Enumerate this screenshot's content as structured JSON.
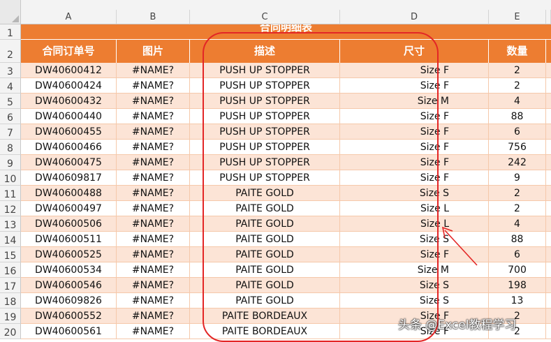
{
  "columns": [
    "A",
    "B",
    "C",
    "D",
    "E"
  ],
  "title": "合同明细表",
  "headers": [
    "合同订单号",
    "图片",
    "描述",
    "尺寸",
    "数量"
  ],
  "row_numbers": [
    "1",
    "2",
    "3",
    "4",
    "5",
    "6",
    "7",
    "8",
    "9",
    "10",
    "11",
    "12",
    "13",
    "14",
    "15",
    "16",
    "17",
    "18",
    "19",
    "20"
  ],
  "rows": [
    {
      "order": "DW40600412",
      "image": "#NAME?",
      "desc": "PUSH UP STOPPER",
      "size": "Size F",
      "qty": "2"
    },
    {
      "order": "DW40600424",
      "image": "#NAME?",
      "desc": "PUSH UP STOPPER",
      "size": "Size F",
      "qty": "2"
    },
    {
      "order": "DW40600432",
      "image": "#NAME?",
      "desc": "PUSH UP STOPPER",
      "size": "Size M",
      "qty": "4"
    },
    {
      "order": "DW40600440",
      "image": "#NAME?",
      "desc": "PUSH UP STOPPER",
      "size": "Size F",
      "qty": "88"
    },
    {
      "order": "DW40600455",
      "image": "#NAME?",
      "desc": "PUSH UP STOPPER",
      "size": "Size F",
      "qty": "6"
    },
    {
      "order": "DW40600466",
      "image": "#NAME?",
      "desc": "PUSH UP STOPPER",
      "size": "Size F",
      "qty": "756"
    },
    {
      "order": "DW40600475",
      "image": "#NAME?",
      "desc": "PUSH UP STOPPER",
      "size": "Size F",
      "qty": "242"
    },
    {
      "order": "DW40609817",
      "image": "#NAME?",
      "desc": "PUSH UP STOPPER",
      "size": "Size F",
      "qty": "9"
    },
    {
      "order": "DW40600488",
      "image": "#NAME?",
      "desc": "PAITE GOLD",
      "size": "Size S",
      "qty": "2"
    },
    {
      "order": "DW40600497",
      "image": "#NAME?",
      "desc": "PAITE GOLD",
      "size": "Size L",
      "qty": "2"
    },
    {
      "order": "DW40600506",
      "image": "#NAME?",
      "desc": "PAITE GOLD",
      "size": "Size L",
      "qty": "4"
    },
    {
      "order": "DW40600511",
      "image": "#NAME?",
      "desc": "PAITE GOLD",
      "size": "Size S",
      "qty": "88"
    },
    {
      "order": "DW40600525",
      "image": "#NAME?",
      "desc": "PAITE GOLD",
      "size": "Size F",
      "qty": "6"
    },
    {
      "order": "DW40600534",
      "image": "#NAME?",
      "desc": "PAITE GOLD",
      "size": "Size M",
      "qty": "700"
    },
    {
      "order": "DW40600546",
      "image": "#NAME?",
      "desc": "PAITE GOLD",
      "size": "Size S",
      "qty": "198"
    },
    {
      "order": "DW40609826",
      "image": "#NAME?",
      "desc": "PAITE GOLD",
      "size": "Size S",
      "qty": "13"
    },
    {
      "order": "DW40600552",
      "image": "#NAME?",
      "desc": "PAITE BORDEAUX",
      "size": "Size F",
      "qty": "2"
    },
    {
      "order": "DW40600561",
      "image": "#NAME?",
      "desc": "PAITE BORDEAUX",
      "size": "Size F",
      "qty": "2"
    }
  ],
  "watermark": "头条 @Excel教程学习",
  "colors": {
    "header_orange": "#ed7d31",
    "band_peach": "#fce4d6",
    "annotation_red": "#e32626"
  }
}
